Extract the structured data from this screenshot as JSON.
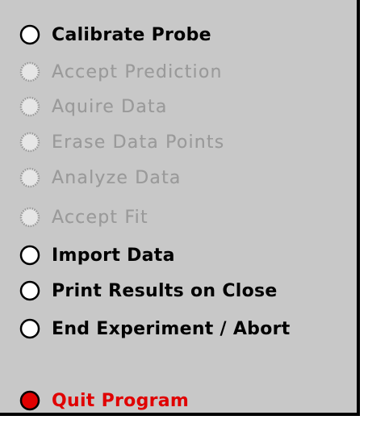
{
  "options": [
    {
      "label": "Calibrate Probe",
      "enabled": true
    },
    {
      "label": "Accept Prediction",
      "enabled": false
    },
    {
      "label": "Aquire Data",
      "enabled": false
    },
    {
      "label": "Erase Data Points",
      "enabled": false
    },
    {
      "label": "Analyze Data",
      "enabled": false
    },
    {
      "label": "Accept Fit",
      "enabled": false
    },
    {
      "label": "Import Data",
      "enabled": true
    },
    {
      "label": "Print Results on Close",
      "enabled": true
    },
    {
      "label": "End Experiment / Abort",
      "enabled": true
    },
    {
      "label": "Quit Program",
      "enabled": true,
      "selected": true
    }
  ],
  "colors": {
    "panel_bg": "#c8c8c8",
    "disabled_text": "#9a9a9a",
    "quit_text": "#e00000",
    "quit_dot": "#e00000"
  }
}
